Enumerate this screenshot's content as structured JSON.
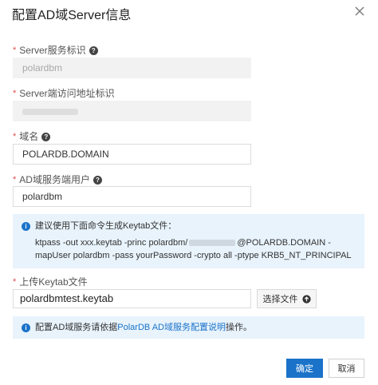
{
  "dialog": {
    "title": "配置AD域Server信息"
  },
  "fields": {
    "server_id": {
      "label": "Server服务标识",
      "value": "polardbm"
    },
    "server_endpoint": {
      "label": "Server端访问地址标识",
      "value": ""
    },
    "domain": {
      "label": "域名",
      "value": "POLARDB.DOMAIN"
    },
    "ad_user": {
      "label": "AD域服务端用户",
      "value": "polardbm"
    }
  },
  "keytab_notice": {
    "intro": "建议使用下面命令生成Keytab文件：",
    "cmd_part1": "ktpass -out xxx.keytab -princ polardbm/",
    "cmd_part2": "@POLARDB.DOMAIN -",
    "cmd_line2": "mapUser polardbm -pass yourPassword -crypto all -ptype KRB5_NT_PRINCIPAL"
  },
  "upload": {
    "label": "上传Keytab文件",
    "file_name": "polardbmtest.keytab",
    "select_label": "选择文件"
  },
  "config_notice": {
    "prefix": "配置AD域服务请依据",
    "link": "PolarDB AD域服务配置说明",
    "suffix": "操作。"
  },
  "footer": {
    "ok_label": "确定",
    "cancel_label": "取消"
  },
  "colors": {
    "primary": "#1a73c9",
    "required": "#e34d4d",
    "notice_bg": "#e8f3fc"
  },
  "icons": {
    "close": "close-icon",
    "help": "question-circle-icon",
    "info": "info-circle-icon",
    "upload": "upload-icon"
  }
}
